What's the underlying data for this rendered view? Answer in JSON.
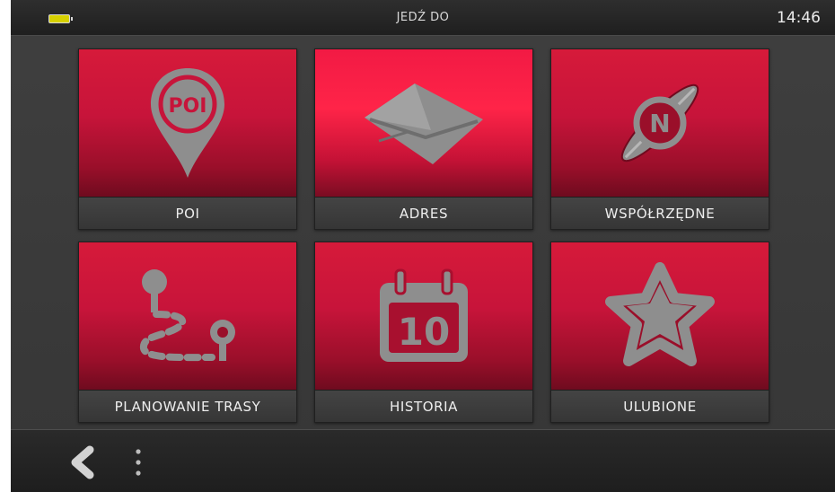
{
  "status": {
    "title": "JEDŹ DO",
    "time": "14:46",
    "battery_icon": "battery-icon",
    "battery_color": "#d6d000"
  },
  "tiles": [
    {
      "label": "POI",
      "icon": "poi-pin-icon",
      "icon_text": "POI"
    },
    {
      "label": "ADRES",
      "icon": "envelope-icon"
    },
    {
      "label": "WSPÓŁRZĘDNE",
      "icon": "compass-icon",
      "icon_text": "N"
    },
    {
      "label": "PLANOWANIE TRASY",
      "icon": "route-icon"
    },
    {
      "label": "HISTORIA",
      "icon": "calendar-icon",
      "icon_text": "10"
    },
    {
      "label": "ULUBIONE",
      "icon": "star-icon"
    }
  ],
  "toolbar": {
    "back_icon": "chevron-left-icon",
    "more_icon": "more-vertical-icon"
  },
  "colors": {
    "tile_red": "#c7143a",
    "tile_red_highlight": "#ff2448",
    "icon_grey": "#8e8e8e",
    "background": "#3a3a3a"
  }
}
